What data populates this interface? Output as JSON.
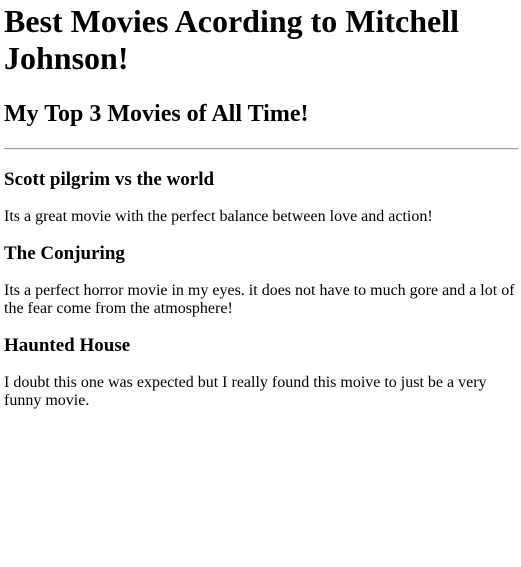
{
  "page": {
    "title": "Best Movies Acording to Mitchell Johnson!",
    "subtitle": "My Top 3 Movies of All Time!"
  },
  "movies": [
    {
      "title": "Scott pilgrim vs the world",
      "description": "Its a great movie with the perfect balance between love and action!"
    },
    {
      "title": "The Conjuring",
      "description": "Its a perfect horror movie in my eyes. it does not have to much gore and a lot of the fear come from the atmosphere!"
    },
    {
      "title": "Haunted House",
      "description": "I doubt this one was expected but I really found this moive to just be a very funny movie."
    }
  ]
}
